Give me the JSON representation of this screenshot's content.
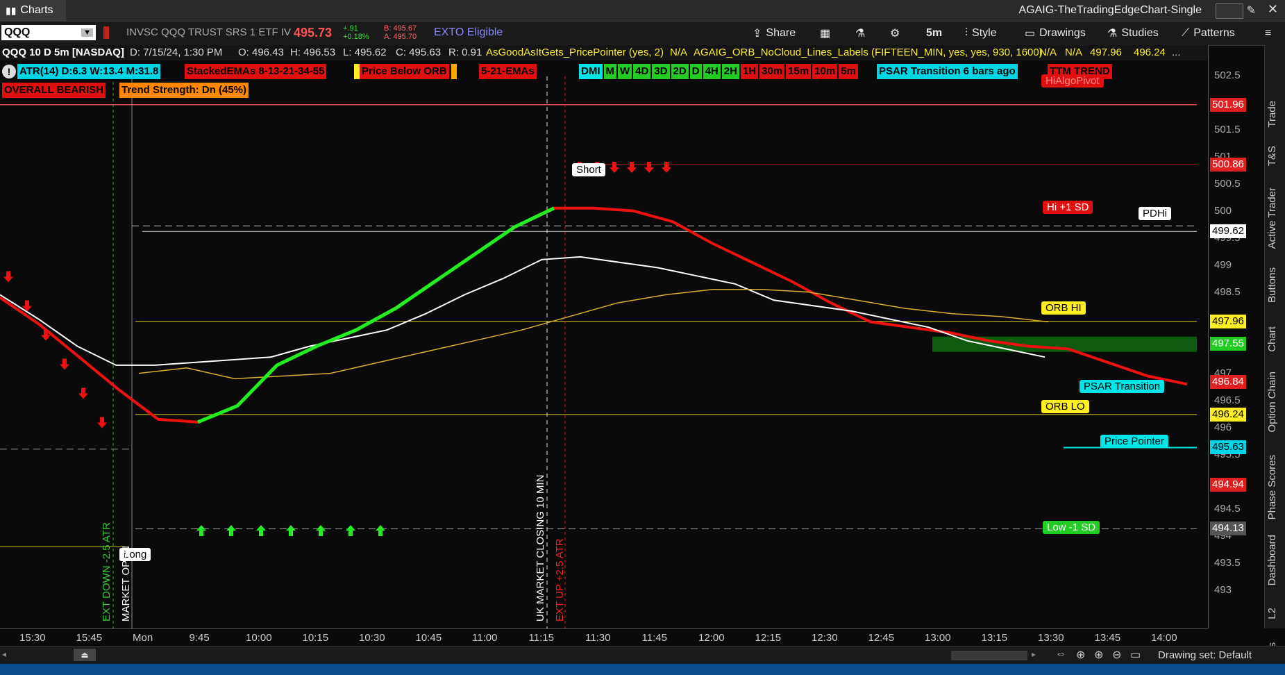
{
  "window": {
    "tab_label": "Charts",
    "title": "AGAIG-TheTradingEdgeChart-Single"
  },
  "toolbar": {
    "symbol": "QQQ",
    "description": "INVSC QQQ TRUST SRS 1 ETF IV",
    "last_price": "495.73",
    "change": "+.91",
    "change_pct": "+0.18%",
    "bid": "B: 495.67",
    "ask": "A: 495.70",
    "exto": "EXTO Eligible",
    "share": "Share",
    "timeframe": "5m",
    "style": "Style",
    "drawings": "Drawings",
    "studies": "Studies",
    "patterns": "Patterns"
  },
  "infobar": {
    "chart_id": "QQQ 10 D 5m [NASDAQ]",
    "date": "D: 7/15/24, 1:30 PM",
    "open": "O: 496.43",
    "high": "H: 496.53",
    "low": "L: 495.62",
    "close": "C: 495.63",
    "range": "R: 0.91",
    "study1": "AsGoodAsItGets_PricePointer (yes, 2)",
    "study1_val": "N/A",
    "study2": "AGAIG_ORB_NoCloud_Lines_Labels (FIFTEEN_MIN, yes, yes, 930, 1600)",
    "study2_v1": "N/A",
    "study2_v2": "N/A",
    "study2_v3": "497.96",
    "study2_v4": "496.24",
    "more": "..."
  },
  "labels_row1": {
    "atr": "ATR(14) D:6.3 W:13.4 M:31.8",
    "stacked": "StackedEMAs 8-13-21-34-55",
    "below_orb": "Price Below ORB",
    "emas": "5-21-EMAs",
    "timeframes": [
      "DMI",
      "M",
      "W",
      "4D",
      "3D",
      "2D",
      "D",
      "4H",
      "2H",
      "1H",
      "30m",
      "15m",
      "10m",
      "5m"
    ],
    "tf_colors": [
      "#00e5e5",
      "#22cc22",
      "#22cc22",
      "#22cc22",
      "#22cc22",
      "#22cc22",
      "#22cc22",
      "#22cc22",
      "#22cc22",
      "#dd1111",
      "#dd1111",
      "#dd1111",
      "#dd1111",
      "#dd1111"
    ],
    "psar": "PSAR Transition 6 bars ago",
    "ttm": "TTM TREND"
  },
  "labels_row2": {
    "overall": "OVERALL BEARISH",
    "trend": "Trend Strength: Dn (45%)"
  },
  "chart_labels": {
    "hi_algo_pivot": "HiAlgoPivot",
    "short": "Short",
    "hi_sd": "Hi +1 SD",
    "pdhi": "PDHi",
    "orb_hi": "ORB HI",
    "psar_transition": "PSAR Transition",
    "orb_lo": "ORB LO",
    "price_pointer": "Price Pointer",
    "low_sd": "Low -1 SD",
    "long": "Long",
    "ext_down": "EXT DOWN -2.5 ATR",
    "market_open": "MARKET OPEN",
    "uk_close": "UK MARKET CLOSING 10 MIN",
    "ext_up": "EXT UP +2.5 ATR"
  },
  "price_axis": {
    "ticks": [
      "502.5",
      "502",
      "501.5",
      "501",
      "500.5",
      "500",
      "499.5",
      "499",
      "498.5",
      "498",
      "497.5",
      "497",
      "496.5",
      "496",
      "495.5",
      "495",
      "494.5",
      "494",
      "493.5",
      "493"
    ],
    "tags": [
      {
        "value": "501.96",
        "bg": "#e02020",
        "fg": "#ffffff"
      },
      {
        "value": "500.86",
        "bg": "#e02020",
        "fg": "#ffffff"
      },
      {
        "value": "499.62",
        "bg": "#ffffff",
        "fg": "#000000"
      },
      {
        "value": "497.96",
        "bg": "#ffee22",
        "fg": "#000000"
      },
      {
        "value": "497.55",
        "bg": "#22cc22",
        "fg": "#ffffff"
      },
      {
        "value": "496.84",
        "bg": "#e02020",
        "fg": "#ffffff"
      },
      {
        "value": "496.24",
        "bg": "#ffee22",
        "fg": "#000000"
      },
      {
        "value": "495.63",
        "bg": "#00d5e5",
        "fg": "#000000"
      },
      {
        "value": "494.94",
        "bg": "#e02020",
        "fg": "#ffffff"
      },
      {
        "value": "494.13",
        "bg": "#555555",
        "fg": "#ffffff"
      }
    ]
  },
  "time_axis": [
    "15:30",
    "15:45",
    "Mon",
    "9:45",
    "10:00",
    "10:15",
    "10:30",
    "10:45",
    "11:00",
    "11:15",
    "11:30",
    "11:45",
    "12:00",
    "12:15",
    "12:30",
    "12:45",
    "13:00",
    "13:15",
    "13:30",
    "13:45",
    "14:00"
  ],
  "right_tabs": [
    "Trade",
    "T&S",
    "Active Trader",
    "Buttons",
    "Chart",
    "Option Chain",
    "Phase Scores",
    "Dashboard",
    "L2",
    "News"
  ],
  "bottom": {
    "drawing_set": "Drawing set: Default"
  },
  "chart_data": {
    "type": "line",
    "x_labels": [
      "15:30",
      "15:45",
      "Mon",
      "9:45",
      "10:00",
      "10:15",
      "10:30",
      "10:45",
      "11:00",
      "11:15",
      "11:30",
      "11:45",
      "12:00",
      "12:15",
      "12:30",
      "12:45",
      "13:00",
      "13:15",
      "13:30"
    ],
    "ylim": [
      492.7,
      502.7
    ],
    "series": [
      {
        "values": [
          498.4,
          497.9,
          497.3,
          496.7,
          496.15,
          496.1,
          496.4,
          497.15,
          497.5,
          497.8,
          498.2,
          498.7,
          499.2,
          499.7,
          500.05,
          500.05,
          500.0,
          499.8,
          499.4,
          499.05,
          498.7,
          498.3,
          497.95,
          497.85,
          497.75,
          497.6,
          497.5,
          497.45,
          497.2,
          496.95,
          496.8
        ],
        "color": "#ee1111",
        "width": 4
      },
      {
        "values": [
          498.45,
          498.0,
          497.5,
          497.15,
          497.15,
          497.2,
          497.25,
          497.3,
          497.5,
          497.65,
          497.8,
          498.1,
          498.45,
          498.75,
          499.1,
          499.15,
          499.05,
          498.95,
          498.8,
          498.65,
          498.35,
          498.25,
          498.15,
          498.0,
          497.85,
          497.6,
          497.45,
          497.3
        ],
        "color": "#ffffff",
        "width": 2
      },
      {
        "values": [
          497.0,
          497.1,
          496.9,
          496.95,
          497.0,
          497.2,
          497.4,
          497.6,
          497.8,
          498.05,
          498.3,
          498.45,
          498.55,
          498.55,
          498.5,
          498.35,
          498.2,
          498.1,
          498.05,
          497.95
        ],
        "color": "#d9b030",
        "width": 1.5
      }
    ],
    "levels": {
      "hi_algo_pivot": 501.96,
      "short": 500.86,
      "pdhi": 499.62,
      "orb_hi": 497.96,
      "orb_lo": 496.24,
      "price_pointer": 495.63,
      "low_sd": 494.13
    }
  }
}
